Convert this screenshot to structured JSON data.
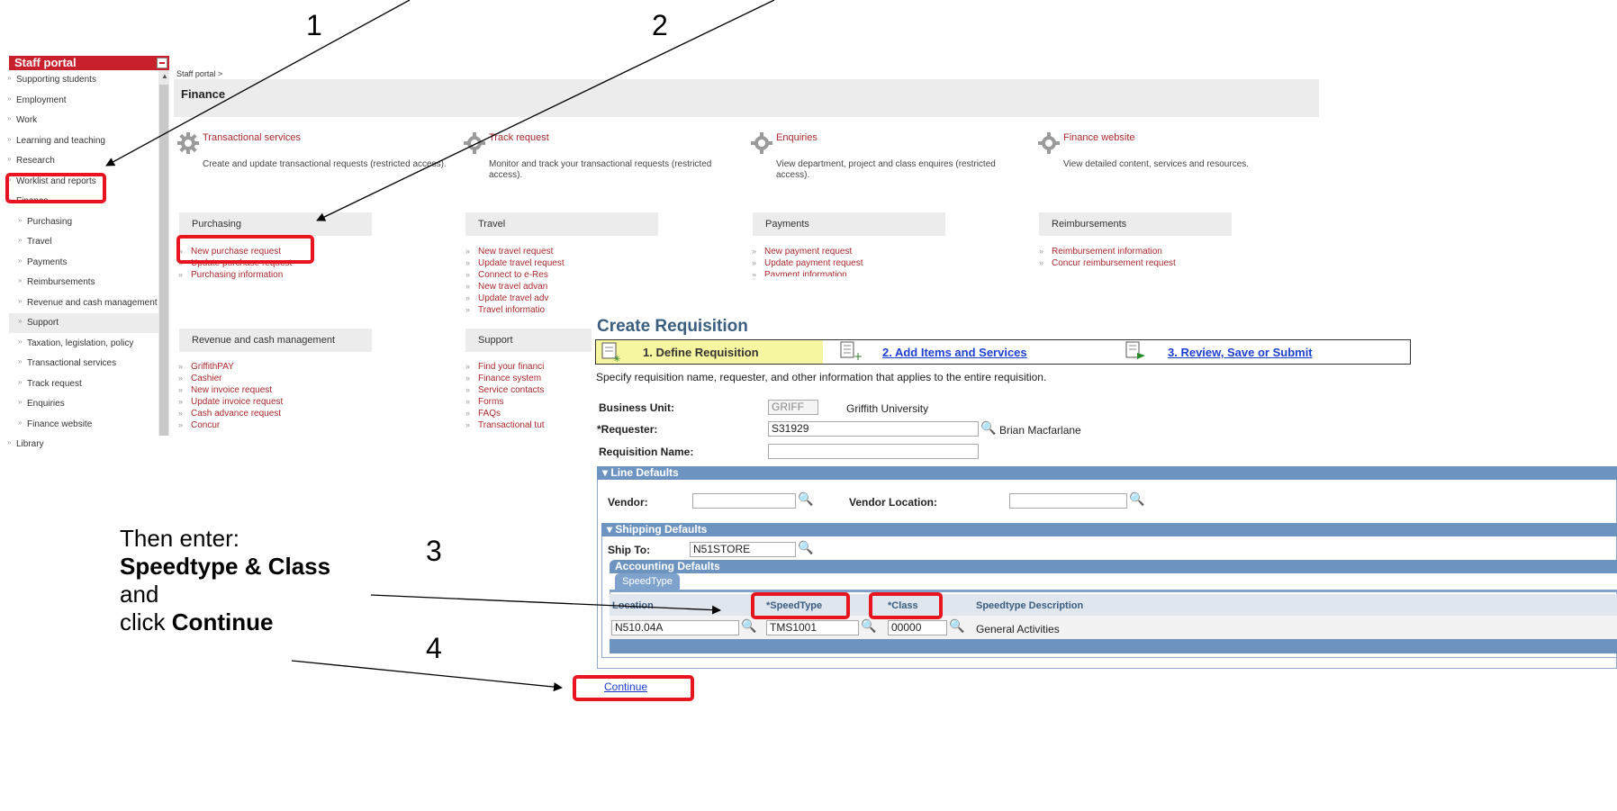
{
  "annotations": {
    "numbers": [
      "1",
      "2",
      "3",
      "4"
    ],
    "note": {
      "line1": "Then enter:",
      "line2": "Speedtype & Class",
      "line3": "and",
      "line4_prefix": "click ",
      "line4_bold": "Continue"
    }
  },
  "sidebar": {
    "title": "Staff portal",
    "items": [
      {
        "label": "Supporting students",
        "level": 0
      },
      {
        "label": "Employment",
        "level": 0
      },
      {
        "label": "Work",
        "level": 0
      },
      {
        "label": "Learning and teaching",
        "level": 0
      },
      {
        "label": "Research",
        "level": 0
      },
      {
        "label": "Worklist and reports",
        "level": 0
      },
      {
        "label": "Finance",
        "level": 0
      },
      {
        "label": "Purchasing",
        "level": 1
      },
      {
        "label": "Travel",
        "level": 1
      },
      {
        "label": "Payments",
        "level": 1
      },
      {
        "label": "Reimbursements",
        "level": 1
      },
      {
        "label": "Revenue and cash management",
        "level": 1
      },
      {
        "label": "Support",
        "level": 1
      },
      {
        "label": "Taxation, legislation, policy",
        "level": 1
      },
      {
        "label": "Transactional services",
        "level": 1
      },
      {
        "label": "Track request",
        "level": 1
      },
      {
        "label": "Enquiries",
        "level": 1
      },
      {
        "label": "Finance website",
        "level": 1
      },
      {
        "label": "Library",
        "level": 0
      }
    ]
  },
  "portal": {
    "breadcrumb": "Staff portal >",
    "page_title": "Finance",
    "tiles": [
      {
        "title": "Transactional services",
        "desc": "Create and update transactional requests (restricted access)."
      },
      {
        "title": "Track request",
        "desc": "Monitor and track your transactional requests (restricted access)."
      },
      {
        "title": "Enquiries",
        "desc": "View department, project and class enquires (restricted access)."
      },
      {
        "title": "Finance website",
        "desc": "View detailed content, services and resources."
      }
    ],
    "purchasing": {
      "heading": "Purchasing",
      "links": [
        "New purchase request",
        "Update purchase request",
        "Purchasing information"
      ]
    },
    "travel": {
      "heading": "Travel",
      "links": [
        "New travel request",
        "Update travel request",
        "Connect to e-Res",
        "New travel advan",
        "Update travel adv",
        "Travel informatio"
      ]
    },
    "payments": {
      "heading": "Payments",
      "links": [
        "New payment request",
        "Update payment request",
        "Payment information"
      ]
    },
    "reimbursements": {
      "heading": "Reimbursements",
      "links": [
        "Reimbursement information",
        "Concur reimbursement request"
      ]
    },
    "revenue": {
      "heading": "Revenue and cash management",
      "links": [
        "GriffithPAY",
        "Cashier",
        "New invoice request",
        "Update invoice request",
        "Cash advance request",
        "Concur"
      ]
    },
    "support": {
      "heading": "Support",
      "links": [
        "Find your financi",
        "Finance system",
        "Service contacts",
        "Forms",
        "FAQs",
        "Transactional tut"
      ]
    }
  },
  "requisition": {
    "title": "Create Requisition",
    "step1": "1. Define Requisition",
    "step2": "2. Add Items and Services",
    "step3": "3. Review, Save or Submit",
    "instructions": "Specify requisition name, requester, and other information that applies to the entire requisition.",
    "business_unit_label": "Business Unit:",
    "business_unit_value": "GRIFF",
    "business_unit_name": "Griffith University",
    "requester_label": "*Requester:",
    "requester_value": "S31929",
    "requester_name": "Brian Macfarlane",
    "req_name_label": "Requisition Name:",
    "req_name_value": "",
    "line_defaults": "Line Defaults",
    "vendor_label": "Vendor:",
    "vendor_value": "",
    "vendor_location_label": "Vendor Location:",
    "vendor_location_value": "",
    "shipping_defaults": "Shipping Defaults",
    "ship_to_label": "Ship To:",
    "ship_to_value": "N51STORE",
    "accounting_defaults": "Accounting Defaults",
    "tab_speedtype": "SpeedType",
    "columns": [
      "Location",
      "*SpeedType",
      "*Class",
      "Speedtype Description"
    ],
    "row": {
      "location": "N510.04A",
      "speedtype": "TMS1001",
      "class": "00000",
      "description": "General Activities"
    },
    "continue": "Continue"
  },
  "colors": {
    "accent_red": "#c8202c",
    "link_red": "#a8282d",
    "annotation_red": "#e8141f",
    "peoplesoft_blue": "#6d93c0"
  }
}
